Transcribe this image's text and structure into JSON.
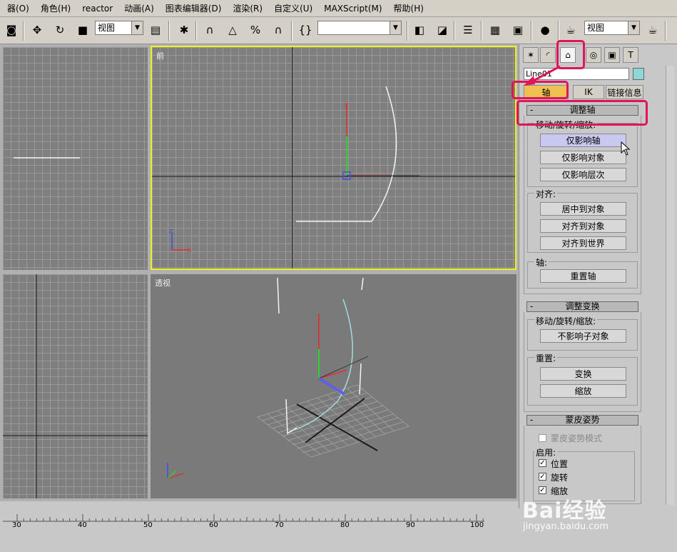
{
  "menu": [
    "器(O)",
    "角色(H)",
    "reactor",
    "动画(A)",
    "图表编辑器(D)",
    "渲染(R)",
    "自定义(U)",
    "MAXScript(M)",
    "帮助(H)"
  ],
  "toolbar": {
    "ref_coord": "视图",
    "named_sel": "",
    "render_view": "视图"
  },
  "viewports": {
    "front_label": "前",
    "persp_label": "透视"
  },
  "panel": {
    "object_name": "Line01",
    "tabs": [
      "轴",
      "IK",
      "链接信息"
    ],
    "adjust_pivot": {
      "title": "调整轴",
      "group_move": "移动/旋转/缩放:",
      "btn_pivot_only": "仅影响轴",
      "btn_object_only": "仅影响对象",
      "btn_hierarchy_only": "仅影响层次",
      "group_align": "对齐:",
      "btn_center": "居中到对象",
      "btn_align_object": "对齐到对象",
      "btn_align_world": "对齐到世界",
      "group_pivot": "轴:",
      "btn_reset_pivot": "重置轴"
    },
    "adjust_transform": {
      "title": "调整变换",
      "group_move": "移动/旋转/缩放:",
      "btn_dont_affect": "不影响子对象",
      "group_reset": "重置:",
      "btn_transform": "变换",
      "btn_scale": "缩放"
    },
    "skin_pose": {
      "title": "蒙皮姿势",
      "mode": "蒙皮姿势模式",
      "group_enable": "启用:",
      "opt_position": "位置",
      "opt_rotation": "旋转",
      "opt_scale": "缩放"
    }
  },
  "timeline": {
    "ticks": [
      "30",
      "40",
      "50",
      "60",
      "70",
      "80",
      "90",
      "100"
    ]
  },
  "watermark": {
    "brand": "Bai经验",
    "url": "jingyan.baidu.com"
  },
  "colors": {
    "highlight": "#e0145a",
    "active_tab": "#f0c050",
    "active_viewport_border": "#f0f020"
  }
}
